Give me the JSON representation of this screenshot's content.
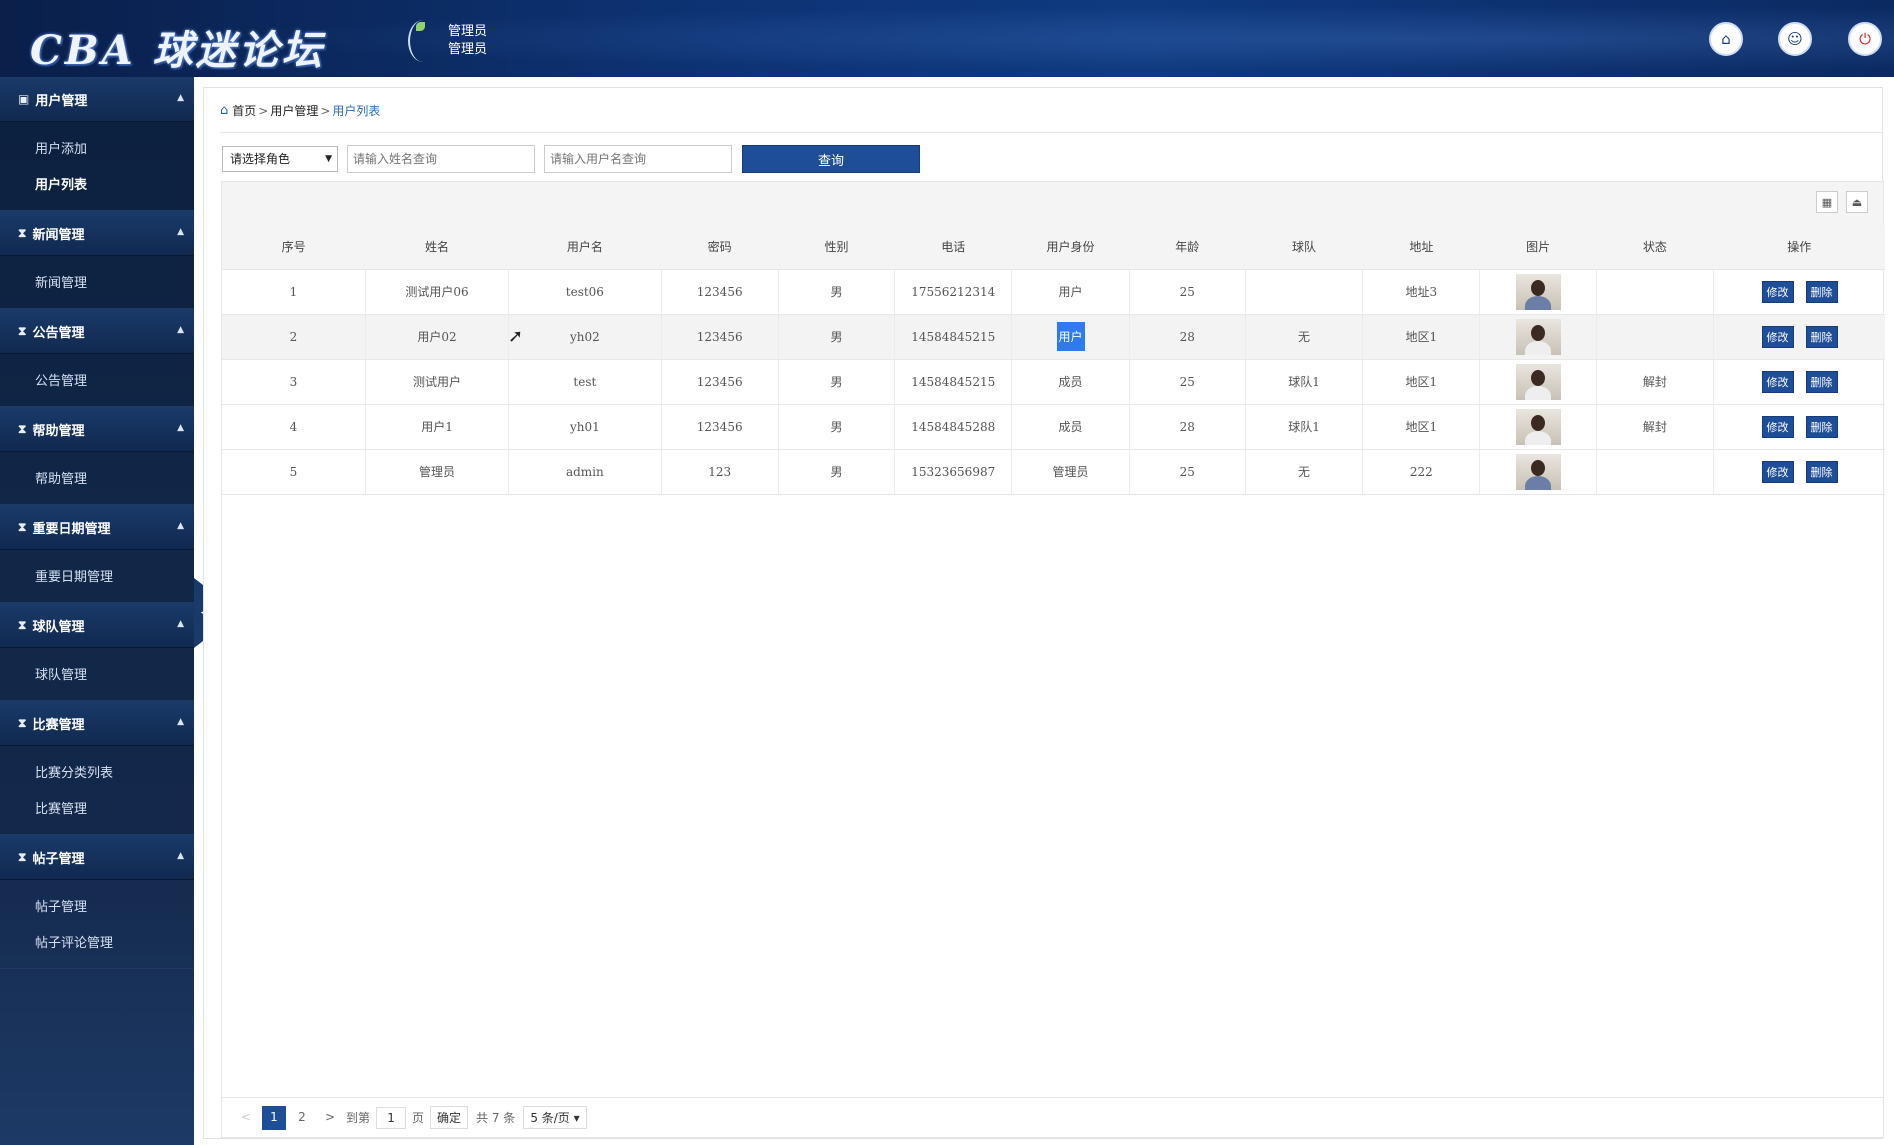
{
  "header": {
    "logo_text": "CBA 球迷论坛",
    "admin_line1": "管理员",
    "admin_line2": "管理员",
    "home_icon": "⌂",
    "user_icon": "☺",
    "power_icon": "⏻"
  },
  "sidebar": {
    "collapse_icon": "◂",
    "groups": [
      {
        "label": "用户管理",
        "items": [
          "用户添加",
          "用户列表"
        ]
      },
      {
        "label": "新闻管理",
        "items": [
          "新闻管理"
        ]
      },
      {
        "label": "公告管理",
        "items": [
          "公告管理"
        ]
      },
      {
        "label": "帮助管理",
        "items": [
          "帮助管理"
        ]
      },
      {
        "label": "重要日期管理",
        "items": [
          "重要日期管理"
        ]
      },
      {
        "label": "球队管理",
        "items": [
          "球队管理"
        ]
      },
      {
        "label": "比赛管理",
        "items": [
          "比赛分类列表",
          "比赛管理"
        ]
      },
      {
        "label": "帖子管理",
        "items": [
          "帖子管理",
          "帖子评论管理"
        ]
      }
    ]
  },
  "breadcrumb": {
    "home": "首页",
    "sep": ">",
    "section": "用户管理",
    "current": "用户列表"
  },
  "search": {
    "role_select": "请选择角色",
    "name_placeholder": "请输入姓名查询",
    "username_placeholder": "请输入用户名查询",
    "query_button": "查询"
  },
  "table": {
    "columns": [
      "序号",
      "姓名",
      "用户名",
      "密码",
      "性别",
      "电话",
      "用户身份",
      "年龄",
      "球队",
      "地址",
      "图片",
      "状态",
      "操作"
    ],
    "edit_label": "修改",
    "delete_label": "删除",
    "rows": [
      {
        "no": "1",
        "name": "测试用户06",
        "username": "test06",
        "password": "123456",
        "gender": "男",
        "phone": "17556212314",
        "role": "用户",
        "age": "25",
        "team": "",
        "address": "地址3",
        "status": ""
      },
      {
        "no": "2",
        "name": "用户02",
        "username": "yh02",
        "password": "123456",
        "gender": "男",
        "phone": "14584845215",
        "role": "用户",
        "age": "28",
        "team": "无",
        "address": "地区1",
        "status": ""
      },
      {
        "no": "3",
        "name": "测试用户",
        "username": "test",
        "password": "123456",
        "gender": "男",
        "phone": "14584845215",
        "role": "成员",
        "age": "25",
        "team": "球队1",
        "address": "地区1",
        "status": "解封"
      },
      {
        "no": "4",
        "name": "用户1",
        "username": "yh01",
        "password": "123456",
        "gender": "男",
        "phone": "14584845288",
        "role": "成员",
        "age": "28",
        "team": "球队1",
        "address": "地区1",
        "status": "解封"
      },
      {
        "no": "5",
        "name": "管理员",
        "username": "admin",
        "password": "123",
        "gender": "男",
        "phone": "15323656987",
        "role": "管理员",
        "age": "25",
        "team": "无",
        "address": "222",
        "status": ""
      }
    ]
  },
  "pager": {
    "prev": "<",
    "page1": "1",
    "page2": "2",
    "next": ">",
    "goto_label": "到第",
    "goto_value": "1",
    "page_unit": "页",
    "confirm": "确定",
    "total": "共 7 条",
    "page_size": "5 条/页"
  }
}
